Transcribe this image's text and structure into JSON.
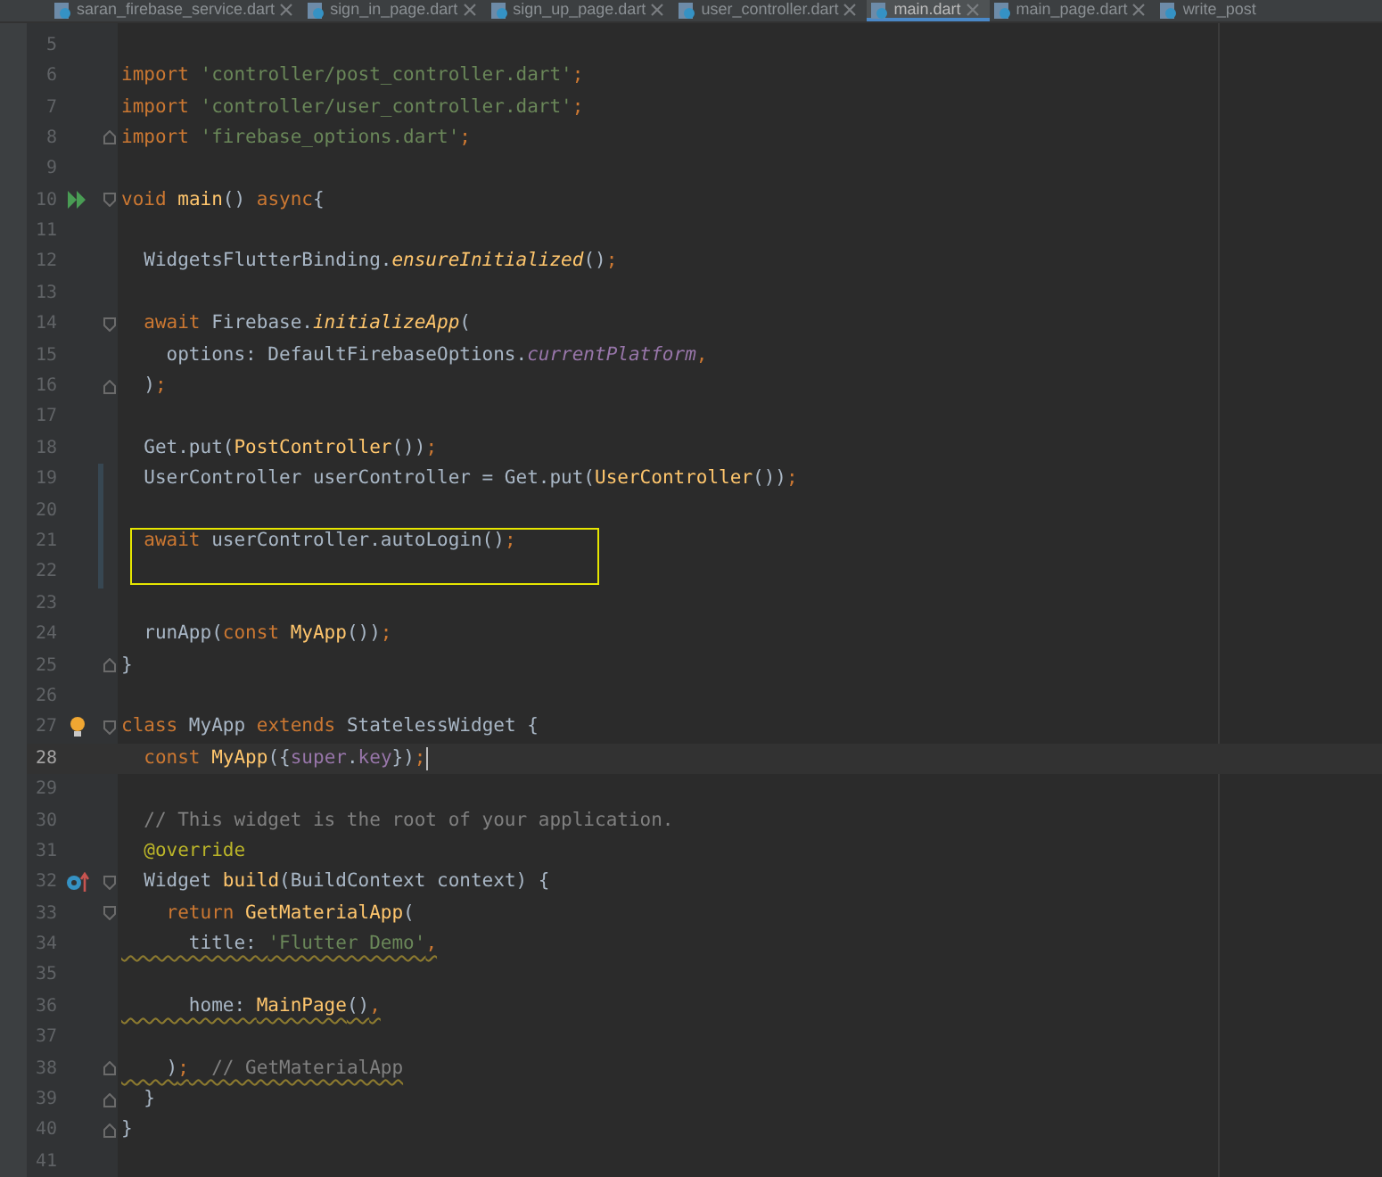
{
  "tabs": [
    {
      "label": "saran_firebase_service.dart",
      "selected": false,
      "closable": true
    },
    {
      "label": "sign_in_page.dart",
      "selected": false,
      "closable": true
    },
    {
      "label": "sign_up_page.dart",
      "selected": false,
      "closable": true
    },
    {
      "label": "user_controller.dart",
      "selected": false,
      "closable": true
    },
    {
      "label": "main.dart",
      "selected": true,
      "closable": true
    },
    {
      "label": "main_page.dart",
      "selected": false,
      "closable": true
    },
    {
      "label": "write_post",
      "selected": false,
      "closable": false
    }
  ],
  "lines": [
    {
      "number": "5",
      "current": false
    },
    {
      "number": "6",
      "current": false,
      "tokens": [
        {
          "text": "import",
          "kind": "kw"
        },
        {
          "text": " 'controller/post_controller.dart'",
          "kind": "str"
        },
        {
          "text": ";",
          "kind": "kw"
        }
      ]
    },
    {
      "number": "7",
      "current": false,
      "tokens": [
        {
          "text": "import",
          "kind": "kw"
        },
        {
          "text": " 'controller/user_controller.dart'",
          "kind": "str"
        },
        {
          "text": ";",
          "kind": "kw"
        }
      ]
    },
    {
      "number": "8",
      "current": false,
      "fold_end": true,
      "tokens": [
        {
          "text": "import",
          "kind": "kw"
        },
        {
          "text": " 'firebase_options.dart'",
          "kind": "str"
        },
        {
          "text": ";",
          "kind": "kw"
        }
      ]
    },
    {
      "number": "9",
      "current": false
    },
    {
      "number": "10",
      "current": false,
      "fold_start": true,
      "runnable": true,
      "tokens": [
        {
          "text": "void",
          "kind": "kw"
        },
        {
          "text": " main",
          "kind": "call"
        },
        {
          "text": "() ",
          "kind": "plain"
        },
        {
          "text": "async",
          "kind": "kw"
        },
        {
          "text": "{",
          "kind": "plain"
        }
      ]
    },
    {
      "number": "11",
      "current": false
    },
    {
      "number": "12",
      "current": false,
      "tokens": [
        {
          "text": "  WidgetsFlutterBinding.",
          "kind": "plain"
        },
        {
          "text": "ensureInitialized",
          "kind": "call_italic"
        },
        {
          "text": "()",
          "kind": "plain"
        },
        {
          "text": ";",
          "kind": "kw"
        }
      ]
    },
    {
      "number": "13",
      "current": false
    },
    {
      "number": "14",
      "current": false,
      "fold_start": true,
      "tokens": [
        {
          "text": "  await",
          "kind": "kw"
        },
        {
          "text": " Firebase.",
          "kind": "plain"
        },
        {
          "text": "initializeApp",
          "kind": "call_italic"
        },
        {
          "text": "(",
          "kind": "plain"
        }
      ]
    },
    {
      "number": "15",
      "current": false,
      "tokens": [
        {
          "text": "    options: DefaultFirebaseOptions.",
          "kind": "plain"
        },
        {
          "text": "currentPlatform",
          "kind": "field_italic"
        },
        {
          "text": ",",
          "kind": "kw"
        }
      ]
    },
    {
      "number": "16",
      "current": false,
      "fold_end": true,
      "tokens": [
        {
          "text": "  )",
          "kind": "plain"
        },
        {
          "text": ";",
          "kind": "kw"
        }
      ]
    },
    {
      "number": "17",
      "current": false
    },
    {
      "number": "18",
      "current": false,
      "tokens": [
        {
          "text": "  Get.put(",
          "kind": "plain"
        },
        {
          "text": "PostController",
          "kind": "call"
        },
        {
          "text": "())",
          "kind": "plain"
        },
        {
          "text": ";",
          "kind": "kw"
        }
      ]
    },
    {
      "number": "19",
      "current": false,
      "changed": true,
      "tokens": [
        {
          "text": "  UserController userController = Get.put(",
          "kind": "plain"
        },
        {
          "text": "UserController",
          "kind": "call"
        },
        {
          "text": "())",
          "kind": "plain"
        },
        {
          "text": ";",
          "kind": "kw"
        }
      ]
    },
    {
      "number": "20",
      "current": false,
      "changed": true
    },
    {
      "number": "21",
      "current": false,
      "changed": true,
      "boxed": true,
      "tokens": [
        {
          "text": "  await",
          "kind": "kw"
        },
        {
          "text": " userController.autoLogin()",
          "kind": "plain"
        },
        {
          "text": ";",
          "kind": "kw"
        }
      ]
    },
    {
      "number": "22",
      "current": false,
      "changed": true,
      "boxed": true
    },
    {
      "number": "23",
      "current": false
    },
    {
      "number": "24",
      "current": false,
      "tokens": [
        {
          "text": "  runApp(",
          "kind": "plain"
        },
        {
          "text": "const",
          "kind": "kw"
        },
        {
          "text": " MyApp",
          "kind": "call"
        },
        {
          "text": "())",
          "kind": "plain"
        },
        {
          "text": ";",
          "kind": "kw"
        }
      ]
    },
    {
      "number": "25",
      "current": false,
      "fold_end": true,
      "tokens": [
        {
          "text": "}",
          "kind": "plain"
        }
      ]
    },
    {
      "number": "26",
      "current": false
    },
    {
      "number": "27",
      "current": false,
      "fold_start": true,
      "intention": true,
      "tokens": [
        {
          "text": "class",
          "kind": "kw"
        },
        {
          "text": " MyApp ",
          "kind": "plain"
        },
        {
          "text": "extends",
          "kind": "kw"
        },
        {
          "text": " StatelessWidget {",
          "kind": "plain"
        }
      ]
    },
    {
      "number": "28",
      "current": true,
      "tokens": [
        {
          "text": "  const",
          "kind": "kw"
        },
        {
          "text": " MyApp",
          "kind": "call"
        },
        {
          "text": "({",
          "kind": "plain"
        },
        {
          "text": "super",
          "kind": "purple"
        },
        {
          "text": ".",
          "kind": "plain"
        },
        {
          "text": "key",
          "kind": "purple"
        },
        {
          "text": "})",
          "kind": "plain"
        },
        {
          "text": ";",
          "kind": "kw"
        }
      ]
    },
    {
      "number": "29",
      "current": false
    },
    {
      "number": "30",
      "current": false,
      "tokens": [
        {
          "text": "  // This widget is the root of your application.",
          "kind": "comment"
        }
      ]
    },
    {
      "number": "31",
      "current": false,
      "tokens": [
        {
          "text": "  @override",
          "kind": "annot"
        }
      ]
    },
    {
      "number": "32",
      "current": false,
      "fold_start": true,
      "overrides": true,
      "tokens": [
        {
          "text": "  Widget ",
          "kind": "plain"
        },
        {
          "text": "build",
          "kind": "call"
        },
        {
          "text": "(BuildContext context) {",
          "kind": "plain"
        }
      ]
    },
    {
      "number": "33",
      "current": false,
      "fold_start": true,
      "tokens": [
        {
          "text": "    return",
          "kind": "kw"
        },
        {
          "text": " GetMaterialApp",
          "kind": "call"
        },
        {
          "text": "(",
          "kind": "plain"
        }
      ]
    },
    {
      "number": "34",
      "current": false,
      "warning": true,
      "tokens": [
        {
          "text": "      title: ",
          "kind": "plain"
        },
        {
          "text": "'Flutter Demo'",
          "kind": "str"
        },
        {
          "text": ",",
          "kind": "kw"
        }
      ]
    },
    {
      "number": "35",
      "current": false
    },
    {
      "number": "36",
      "current": false,
      "warning": true,
      "tokens": [
        {
          "text": "      home: ",
          "kind": "plain"
        },
        {
          "text": "MainPage",
          "kind": "call"
        },
        {
          "text": "()",
          "kind": "plain"
        },
        {
          "text": ",",
          "kind": "kw"
        }
      ]
    },
    {
      "number": "37",
      "current": false
    },
    {
      "number": "38",
      "current": false,
      "fold_end": true,
      "warning": true,
      "tokens": [
        {
          "text": "    )",
          "kind": "plain"
        },
        {
          "text": ";",
          "kind": "kw"
        },
        {
          "text": "  // GetMaterialApp",
          "kind": "comment"
        }
      ]
    },
    {
      "number": "39",
      "current": false,
      "fold_end": true,
      "tokens": [
        {
          "text": "  }",
          "kind": "plain"
        }
      ]
    },
    {
      "number": "40",
      "current": false,
      "fold_end": true,
      "tokens": [
        {
          "text": "}",
          "kind": "plain"
        }
      ]
    },
    {
      "number": "41",
      "current": false
    }
  ]
}
